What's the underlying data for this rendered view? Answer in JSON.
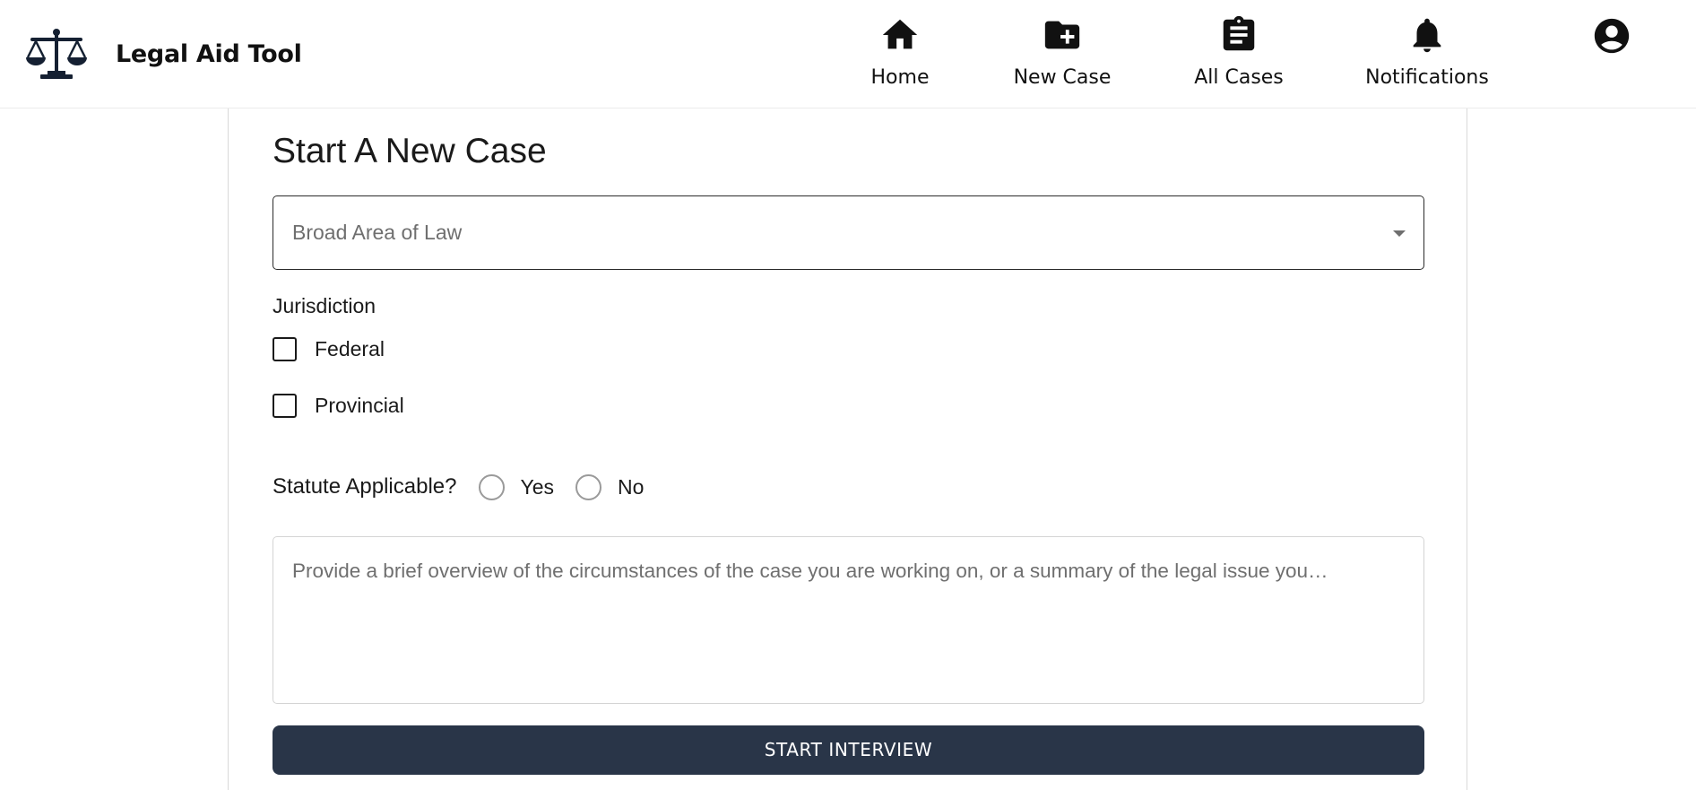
{
  "header": {
    "title": "Legal Aid Tool",
    "logo_icon": "scales-of-justice-icon",
    "nav": [
      {
        "label": "Home",
        "icon": "home-icon"
      },
      {
        "label": "New Case",
        "icon": "folder-plus-icon"
      },
      {
        "label": "All Cases",
        "icon": "clipboard-list-icon"
      },
      {
        "label": "Notifications",
        "icon": "bell-icon"
      }
    ],
    "profile_icon": "user-circle-icon"
  },
  "form": {
    "title": "Start A New Case",
    "area_of_law": {
      "placeholder": "Broad Area of Law",
      "selected": ""
    },
    "jurisdiction": {
      "label": "Jurisdiction",
      "options": [
        {
          "label": "Federal",
          "checked": false
        },
        {
          "label": "Provincial",
          "checked": false
        }
      ]
    },
    "statute": {
      "label": "Statute Applicable?",
      "options": [
        {
          "label": "Yes",
          "selected": false
        },
        {
          "label": "No",
          "selected": false
        }
      ]
    },
    "overview": {
      "placeholder": "Provide a brief overview of the circumstances of the case you are working on, or a summary of the legal issue you…",
      "value": ""
    },
    "submit_label": "START INTERVIEW"
  },
  "colors": {
    "accent": "#293548",
    "text": "#111111",
    "placeholder": "#6f6f6f",
    "border": "#d9d9d9"
  }
}
